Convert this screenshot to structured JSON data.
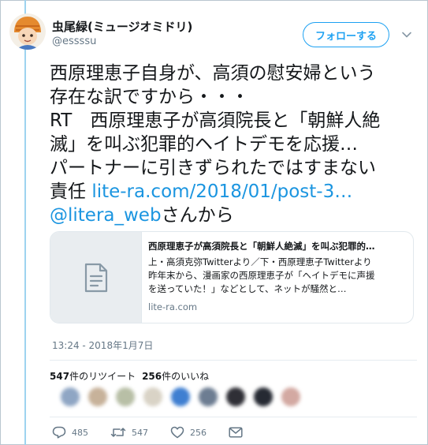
{
  "user": {
    "display_name": "虫尾緑(ミュージオミドリ)",
    "handle": "@essssu",
    "follow_label": "フォローする"
  },
  "tweet": {
    "lines": [
      "西原理恵子自身が、高須の慰安婦という",
      "存在な訳ですから・・・",
      "RT　西原理恵子が高須院長と「朝鮮人絶",
      "滅」を叫ぶ犯罪的ヘイトデモを応援…",
      "パートナーに引きずられたではすまない"
    ],
    "line6_prefix": "責任 ",
    "link_url": "lite-ra.com/2018/01/post-3…",
    "mention": "@litera_web",
    "mention_suffix": "さんから"
  },
  "card": {
    "title": "西原理恵子が高須院長と「朝鮮人絶滅」を叫ぶ犯罪的…",
    "description_lines": [
      "上・高須克弥Twitterより／下・西原理恵子Twitterより",
      "昨年末から、漫画家の西原理恵子が「ヘイトデモに声援",
      "を送っていた！」などとして、ネットが騒然と…"
    ],
    "domain": "lite-ra.com",
    "thumb_icon": "document-icon"
  },
  "timestamp": "13:24 - 2018年1月7日",
  "stats": {
    "retweets_count": "547",
    "retweets_label": "件のリツイート",
    "likes_count": "256",
    "likes_label": "件のいいね"
  },
  "liker_colors": [
    "#8fa6c4",
    "#c7b29a",
    "#b8bfa6",
    "#d9d3c6",
    "#3f7fd1",
    "#6d7d92",
    "#2f2f36",
    "#262a33",
    "#d3a9a2"
  ],
  "actions": {
    "reply_count": "485",
    "retweet_count": "547",
    "like_count": "256"
  },
  "colors": {
    "accent": "#1da1f2",
    "link": "#1b95e0",
    "muted": "#657786"
  }
}
